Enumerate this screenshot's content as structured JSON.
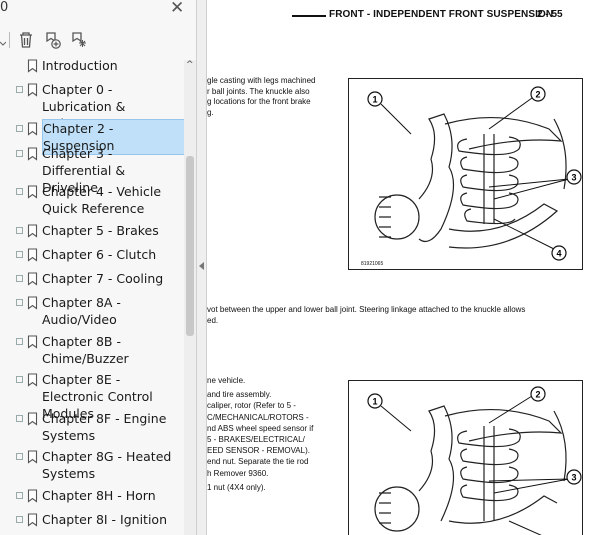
{
  "app": {
    "panel_label": "0",
    "close_icon": "close-icon"
  },
  "toolbar": {
    "icons": [
      "trash-icon",
      "add-bookmark-icon",
      "bookmark-options-icon"
    ]
  },
  "bookmarks": [
    {
      "label": "Introduction",
      "selected": false
    },
    {
      "label": "Chapter 0 - Lubrication & Maintenance",
      "selected": false
    },
    {
      "label": "Chapter 2 - Suspension",
      "selected": true
    },
    {
      "label": "Chapter 3 - Differential & Driveline",
      "selected": false
    },
    {
      "label": "Chapter 4 - Vehicle Quick Reference",
      "selected": false
    },
    {
      "label": "Chapter 5 - Brakes",
      "selected": false
    },
    {
      "label": "Chapter 6 - Clutch",
      "selected": false
    },
    {
      "label": "Chapter 7 - Cooling",
      "selected": false
    },
    {
      "label": "Chapter 8A - Audio/Video",
      "selected": false
    },
    {
      "label": "Chapter 8B - Chime/Buzzer",
      "selected": false
    },
    {
      "label": "Chapter 8E - Electronic Control Modules",
      "selected": false
    },
    {
      "label": "Chapter 8F - Engine Systems",
      "selected": false
    },
    {
      "label": "Chapter 8G - Heated Systems",
      "selected": false
    },
    {
      "label": "Chapter 8H - Horn",
      "selected": false
    },
    {
      "label": "Chapter 8I - Ignition",
      "selected": false
    }
  ],
  "document": {
    "header_title": "FRONT - INDEPENDENT FRONT SUSPENSION",
    "page_number": "2 - 55",
    "para1": [
      "gle casting with legs machined",
      "r ball joints. The knuckle also",
      "g locations for the front brake",
      "g."
    ],
    "para2": [
      "vot between the upper and lower ball joint. Steering linkage attached to the knuckle allows",
      "ed."
    ],
    "para3": [
      "ne vehicle.",
      "and tire assembly.",
      "caliper, rotor (Refer to 5  -",
      "C/MECHANICAL/ROTORS   -",
      "nd ABS wheel speed sensor if",
      "5  -  BRAKES/ELECTRICAL/",
      "EED SENSOR - REMOVAL).",
      "end nut. Separate the tie rod",
      "h Remover 9360.",
      "1 nut (4X4 only)."
    ],
    "figure1": {
      "id": "81921065",
      "callouts": [
        "1",
        "2",
        "3",
        "4"
      ]
    },
    "figure2": {
      "callouts": [
        "1",
        "2",
        "3"
      ]
    }
  }
}
